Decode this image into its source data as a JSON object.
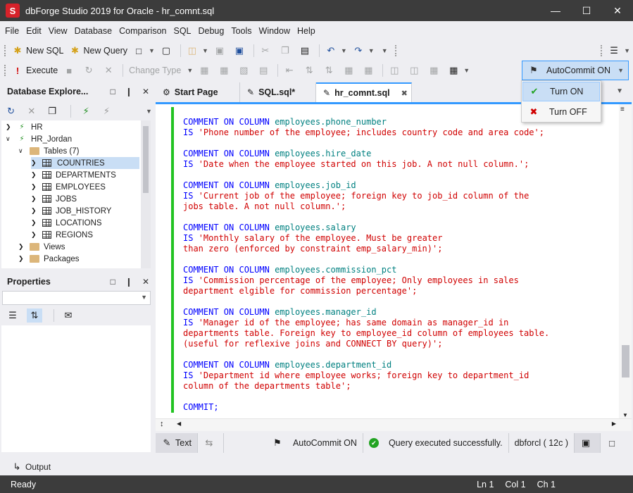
{
  "app": {
    "title": "dbForge Studio 2019 for Oracle - hr_comnt.sql",
    "logo_letter": "S"
  },
  "menu": [
    "File",
    "Edit",
    "View",
    "Database",
    "Comparison",
    "SQL",
    "Debug",
    "Tools",
    "Window",
    "Help"
  ],
  "toolbar1": {
    "new_sql": "New SQL",
    "new_query": "New Query"
  },
  "toolbar2": {
    "execute": "Execute",
    "change_type": "Change Type",
    "autocommit": "AutoCommit ON"
  },
  "autocommit_menu": {
    "turn_on": "Turn ON",
    "turn_off": "Turn OFF"
  },
  "db_explorer": {
    "title": "Database Explore...",
    "tree": [
      {
        "label": "HR",
        "level": 0,
        "type": "conn",
        "expanded": false
      },
      {
        "label": "HR_Jordan",
        "level": 0,
        "type": "conn",
        "expanded": true
      },
      {
        "label": "Tables (7)",
        "level": 1,
        "type": "folder",
        "expanded": true
      },
      {
        "label": "COUNTRIES",
        "level": 2,
        "type": "table",
        "selected": true
      },
      {
        "label": "DEPARTMENTS",
        "level": 2,
        "type": "table"
      },
      {
        "label": "EMPLOYEES",
        "level": 2,
        "type": "table"
      },
      {
        "label": "JOBS",
        "level": 2,
        "type": "table"
      },
      {
        "label": "JOB_HISTORY",
        "level": 2,
        "type": "table"
      },
      {
        "label": "LOCATIONS",
        "level": 2,
        "type": "table"
      },
      {
        "label": "REGIONS",
        "level": 2,
        "type": "table"
      },
      {
        "label": "Views",
        "level": 1,
        "type": "folder"
      },
      {
        "label": "Packages",
        "level": 1,
        "type": "folder"
      }
    ]
  },
  "properties": {
    "title": "Properties"
  },
  "tabs": [
    {
      "label": "Start Page",
      "active": false
    },
    {
      "label": "SQL.sql*",
      "active": false
    },
    {
      "label": "hr_comnt.sql",
      "active": true
    }
  ],
  "code_blocks": [
    {
      "column": "employees.phone_number",
      "lines": [
        "'Phone number of the employee; includes country code and area code';"
      ]
    },
    {
      "column": "employees.hire_date",
      "lines": [
        "'Date when the employee started on this job. A not null column.';"
      ]
    },
    {
      "column": "employees.job_id",
      "lines": [
        "'Current job of the employee; foreign key to job_id column of the",
        "jobs table. A not null column.';"
      ]
    },
    {
      "column": "employees.salary",
      "lines": [
        "'Monthly salary of the employee. Must be greater",
        "than zero (enforced by constraint emp_salary_min)';"
      ]
    },
    {
      "column": "employees.commission_pct",
      "lines": [
        "'Commission percentage of the employee; Only employees in sales",
        "department elgible for commission percentage';"
      ]
    },
    {
      "column": "employees.manager_id",
      "lines": [
        "'Manager id of the employee; has same domain as manager_id in",
        "departments table. Foreign key to employee_id column of employees table.",
        "(useful for reflexive joins and CONNECT BY query)';"
      ]
    },
    {
      "column": "employees.department_id",
      "lines": [
        "'Department id where employee works; foreign key to department_id",
        "column of the departments table';"
      ]
    }
  ],
  "code_keywords": {
    "comment_on_column": "COMMENT ON COLUMN",
    "is": "IS",
    "commit": "COMMIT;"
  },
  "editor_status": {
    "text_mode": "Text",
    "autocommit": "AutoCommit ON",
    "message": "Query executed successfully.",
    "connection": "dbforcl ( 12c )"
  },
  "output_label": "Output",
  "statusbar": {
    "state": "Ready",
    "ln": "Ln 1",
    "col": "Col 1",
    "ch": "Ch 1"
  }
}
